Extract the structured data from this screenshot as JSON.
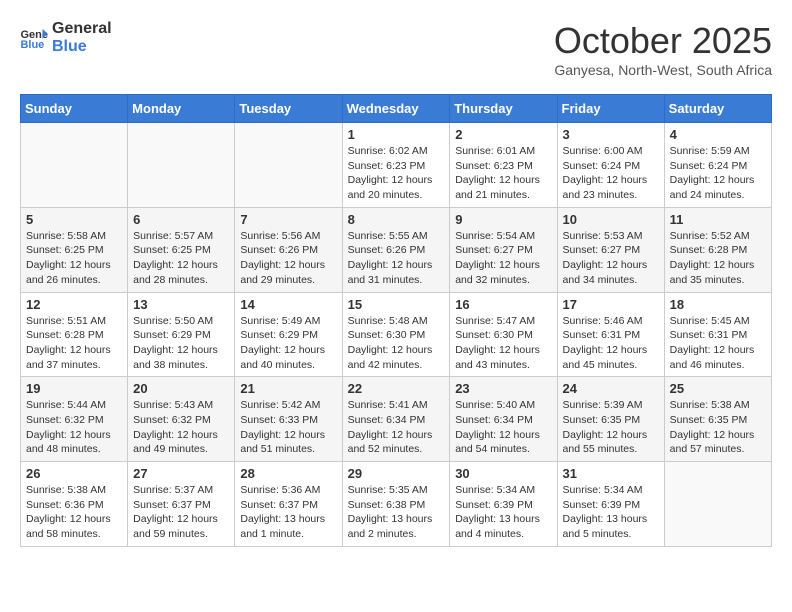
{
  "header": {
    "logo_general": "General",
    "logo_blue": "Blue",
    "month": "October 2025",
    "location": "Ganyesa, North-West, South Africa"
  },
  "weekdays": [
    "Sunday",
    "Monday",
    "Tuesday",
    "Wednesday",
    "Thursday",
    "Friday",
    "Saturday"
  ],
  "weeks": [
    [
      {
        "day": "",
        "info": ""
      },
      {
        "day": "",
        "info": ""
      },
      {
        "day": "",
        "info": ""
      },
      {
        "day": "1",
        "info": "Sunrise: 6:02 AM\nSunset: 6:23 PM\nDaylight: 12 hours\nand 20 minutes."
      },
      {
        "day": "2",
        "info": "Sunrise: 6:01 AM\nSunset: 6:23 PM\nDaylight: 12 hours\nand 21 minutes."
      },
      {
        "day": "3",
        "info": "Sunrise: 6:00 AM\nSunset: 6:24 PM\nDaylight: 12 hours\nand 23 minutes."
      },
      {
        "day": "4",
        "info": "Sunrise: 5:59 AM\nSunset: 6:24 PM\nDaylight: 12 hours\nand 24 minutes."
      }
    ],
    [
      {
        "day": "5",
        "info": "Sunrise: 5:58 AM\nSunset: 6:25 PM\nDaylight: 12 hours\nand 26 minutes."
      },
      {
        "day": "6",
        "info": "Sunrise: 5:57 AM\nSunset: 6:25 PM\nDaylight: 12 hours\nand 28 minutes."
      },
      {
        "day": "7",
        "info": "Sunrise: 5:56 AM\nSunset: 6:26 PM\nDaylight: 12 hours\nand 29 minutes."
      },
      {
        "day": "8",
        "info": "Sunrise: 5:55 AM\nSunset: 6:26 PM\nDaylight: 12 hours\nand 31 minutes."
      },
      {
        "day": "9",
        "info": "Sunrise: 5:54 AM\nSunset: 6:27 PM\nDaylight: 12 hours\nand 32 minutes."
      },
      {
        "day": "10",
        "info": "Sunrise: 5:53 AM\nSunset: 6:27 PM\nDaylight: 12 hours\nand 34 minutes."
      },
      {
        "day": "11",
        "info": "Sunrise: 5:52 AM\nSunset: 6:28 PM\nDaylight: 12 hours\nand 35 minutes."
      }
    ],
    [
      {
        "day": "12",
        "info": "Sunrise: 5:51 AM\nSunset: 6:28 PM\nDaylight: 12 hours\nand 37 minutes."
      },
      {
        "day": "13",
        "info": "Sunrise: 5:50 AM\nSunset: 6:29 PM\nDaylight: 12 hours\nand 38 minutes."
      },
      {
        "day": "14",
        "info": "Sunrise: 5:49 AM\nSunset: 6:29 PM\nDaylight: 12 hours\nand 40 minutes."
      },
      {
        "day": "15",
        "info": "Sunrise: 5:48 AM\nSunset: 6:30 PM\nDaylight: 12 hours\nand 42 minutes."
      },
      {
        "day": "16",
        "info": "Sunrise: 5:47 AM\nSunset: 6:30 PM\nDaylight: 12 hours\nand 43 minutes."
      },
      {
        "day": "17",
        "info": "Sunrise: 5:46 AM\nSunset: 6:31 PM\nDaylight: 12 hours\nand 45 minutes."
      },
      {
        "day": "18",
        "info": "Sunrise: 5:45 AM\nSunset: 6:31 PM\nDaylight: 12 hours\nand 46 minutes."
      }
    ],
    [
      {
        "day": "19",
        "info": "Sunrise: 5:44 AM\nSunset: 6:32 PM\nDaylight: 12 hours\nand 48 minutes."
      },
      {
        "day": "20",
        "info": "Sunrise: 5:43 AM\nSunset: 6:32 PM\nDaylight: 12 hours\nand 49 minutes."
      },
      {
        "day": "21",
        "info": "Sunrise: 5:42 AM\nSunset: 6:33 PM\nDaylight: 12 hours\nand 51 minutes."
      },
      {
        "day": "22",
        "info": "Sunrise: 5:41 AM\nSunset: 6:34 PM\nDaylight: 12 hours\nand 52 minutes."
      },
      {
        "day": "23",
        "info": "Sunrise: 5:40 AM\nSunset: 6:34 PM\nDaylight: 12 hours\nand 54 minutes."
      },
      {
        "day": "24",
        "info": "Sunrise: 5:39 AM\nSunset: 6:35 PM\nDaylight: 12 hours\nand 55 minutes."
      },
      {
        "day": "25",
        "info": "Sunrise: 5:38 AM\nSunset: 6:35 PM\nDaylight: 12 hours\nand 57 minutes."
      }
    ],
    [
      {
        "day": "26",
        "info": "Sunrise: 5:38 AM\nSunset: 6:36 PM\nDaylight: 12 hours\nand 58 minutes."
      },
      {
        "day": "27",
        "info": "Sunrise: 5:37 AM\nSunset: 6:37 PM\nDaylight: 12 hours\nand 59 minutes."
      },
      {
        "day": "28",
        "info": "Sunrise: 5:36 AM\nSunset: 6:37 PM\nDaylight: 13 hours\nand 1 minute."
      },
      {
        "day": "29",
        "info": "Sunrise: 5:35 AM\nSunset: 6:38 PM\nDaylight: 13 hours\nand 2 minutes."
      },
      {
        "day": "30",
        "info": "Sunrise: 5:34 AM\nSunset: 6:39 PM\nDaylight: 13 hours\nand 4 minutes."
      },
      {
        "day": "31",
        "info": "Sunrise: 5:34 AM\nSunset: 6:39 PM\nDaylight: 13 hours\nand 5 minutes."
      },
      {
        "day": "",
        "info": ""
      }
    ]
  ]
}
